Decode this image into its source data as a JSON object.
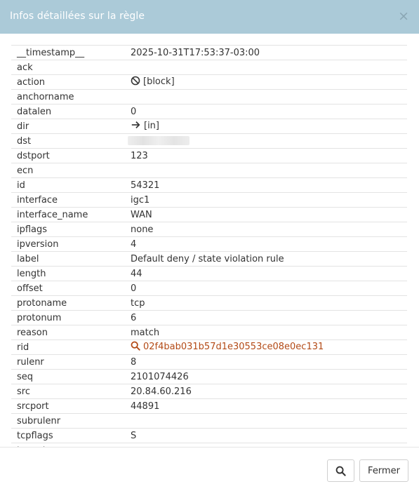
{
  "dialog": {
    "title": "Infos détaillées sur la règle",
    "close_symbol": "×"
  },
  "rows": [
    {
      "key": "__timestamp__",
      "value": "2025-10-31T17:53:37-03:00"
    },
    {
      "key": "ack",
      "value": ""
    },
    {
      "key": "action",
      "value": "[block]",
      "icon": "block-icon"
    },
    {
      "key": "anchorname",
      "value": ""
    },
    {
      "key": "datalen",
      "value": "0"
    },
    {
      "key": "dir",
      "value": "[in]",
      "icon": "arrow-right-icon"
    },
    {
      "key": "dst",
      "value": "",
      "redacted": true
    },
    {
      "key": "dstport",
      "value": "123"
    },
    {
      "key": "ecn",
      "value": ""
    },
    {
      "key": "id",
      "value": "54321"
    },
    {
      "key": "interface",
      "value": "igc1"
    },
    {
      "key": "interface_name",
      "value": "WAN"
    },
    {
      "key": "ipflags",
      "value": "none"
    },
    {
      "key": "ipversion",
      "value": "4"
    },
    {
      "key": "label",
      "value": "Default deny / state violation rule"
    },
    {
      "key": "length",
      "value": "44"
    },
    {
      "key": "offset",
      "value": "0"
    },
    {
      "key": "protoname",
      "value": "tcp"
    },
    {
      "key": "protonum",
      "value": "6"
    },
    {
      "key": "reason",
      "value": "match"
    },
    {
      "key": "rid",
      "value": "02f4bab031b57d1e30553ce08e0ec131",
      "icon": "search-icon",
      "link": true
    },
    {
      "key": "rulenr",
      "value": "8"
    },
    {
      "key": "seq",
      "value": "2101074426"
    },
    {
      "key": "src",
      "value": "20.84.60.216"
    },
    {
      "key": "srcport",
      "value": "44891"
    },
    {
      "key": "subrulenr",
      "value": ""
    },
    {
      "key": "tcpflags",
      "value": "S"
    },
    {
      "key": "tcpopts",
      "value": ""
    }
  ],
  "footer": {
    "search_icon": "search-icon",
    "close_label": "Fermer"
  },
  "colors": {
    "header_bg": "#abcad8",
    "link": "#b34a16"
  }
}
